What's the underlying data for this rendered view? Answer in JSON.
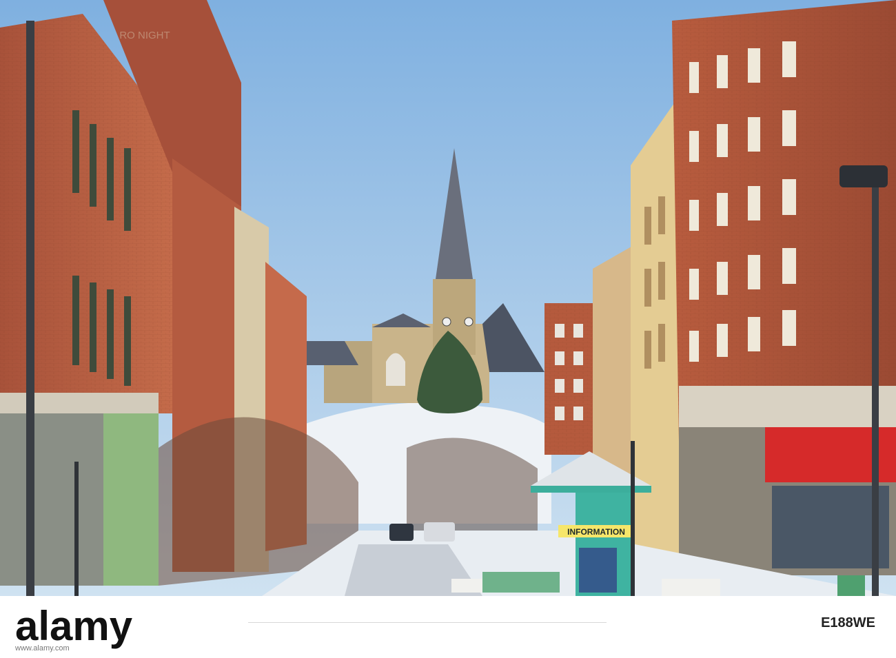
{
  "scene": {
    "kiosk_sign": "INFORMATION",
    "building_sign_top": "RO NIGHT"
  },
  "watermark": {
    "logo_text": "alamy",
    "image_id": "E188WE",
    "site_url": "www.alamy.com"
  }
}
